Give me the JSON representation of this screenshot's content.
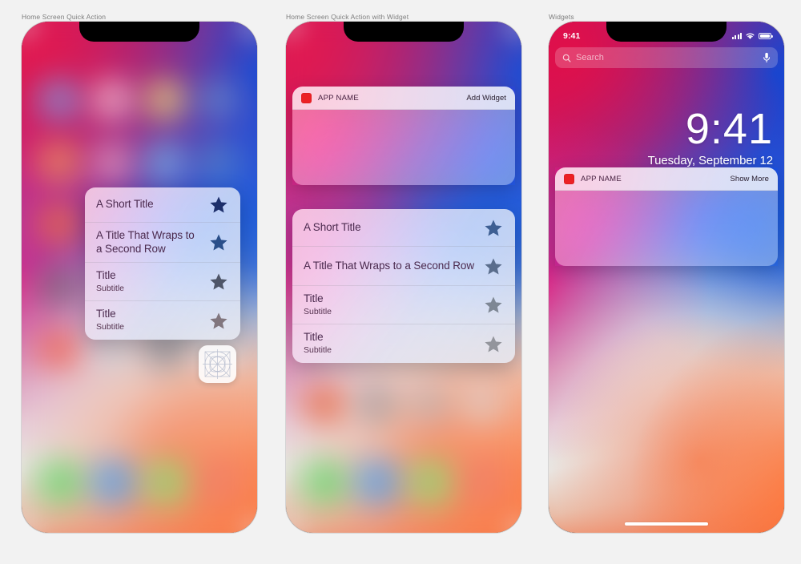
{
  "page": {
    "background": "#f2f2f2"
  },
  "panels": [
    {
      "caption": "Home Screen Quick Action"
    },
    {
      "caption": "Home Screen Quick Action with Widget"
    },
    {
      "caption": "Widgets"
    }
  ],
  "quick_action_menu": {
    "rows": [
      {
        "title": "A Short Title",
        "subtitle": "",
        "icon": "star-icon",
        "icon_color": "#1d2f6b"
      },
      {
        "title": "A Title That Wraps to a Second Row",
        "subtitle": "",
        "icon": "star-icon",
        "icon_color": "#2a4f8a"
      },
      {
        "title": "Title",
        "subtitle": "Subtitle",
        "icon": "star-icon",
        "icon_color": "#4e5568"
      },
      {
        "title": "Title",
        "subtitle": "Subtitle",
        "icon": "star-icon",
        "icon_color": "#81767e"
      }
    ]
  },
  "widget_add": {
    "app_name": "APP NAME",
    "action_label": "Add Widget",
    "icon": "app-square-icon",
    "icon_color": "#ec2024"
  },
  "widget_show": {
    "app_name": "APP NAME",
    "action_label": "Show More",
    "icon": "app-square-icon",
    "icon_color": "#ec2024"
  },
  "status_bar": {
    "time": "9:41",
    "signal_icon": "cellular-signal-icon",
    "wifi_icon": "wifi-icon",
    "battery_icon": "battery-full-icon"
  },
  "search": {
    "placeholder": "Search",
    "search_icon": "search-icon",
    "mic_icon": "microphone-icon"
  },
  "lockclock": {
    "time": "9:41",
    "date": "Tuesday, September 12"
  },
  "home_indicator": {
    "label": "home-indicator"
  },
  "icon_template": {
    "label": "app-icon-grid-template"
  },
  "colors": {
    "accent_red": "#ec2024",
    "title_text": "#4b2a4e",
    "caption_text": "#7d7d7d",
    "page_bg": "#f2f2f2"
  }
}
